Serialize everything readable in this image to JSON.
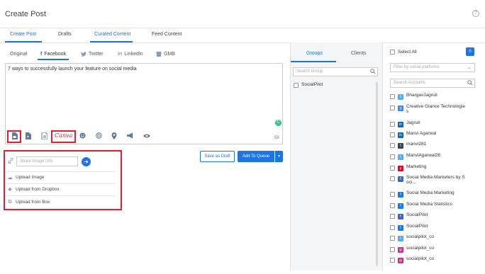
{
  "page": {
    "title": "Create Post",
    "help_icon": "?"
  },
  "top_tabs": [
    "Create Post",
    "Drafts",
    "Curated Content",
    "Feed Content"
  ],
  "network_tabs": [
    {
      "label": "Original",
      "icon": ""
    },
    {
      "label": "Facebook",
      "icon": "f"
    },
    {
      "label": "Twitter",
      "icon": "twitter-icon"
    },
    {
      "label": "LinkedIn",
      "icon": "in"
    },
    {
      "label": "GMB",
      "icon": "gmb-icon"
    }
  ],
  "editor": {
    "text": "7 ways to successfully launch your feature on social media",
    "char_count": "58",
    "badge": "C"
  },
  "toolbar": {
    "canva_label": "Canva"
  },
  "actions": {
    "save_draft": "Save as Draft",
    "add_queue": "Add To Queue",
    "caret": "▾"
  },
  "media": {
    "url_placeholder": "Share Image Urls",
    "go": "➔",
    "uploads": [
      "Upload Image",
      "Upload from Dropbox",
      "Upload from Box"
    ]
  },
  "groups_panel": {
    "tabs": [
      "Groups",
      "Clients"
    ],
    "search_placeholder": "Search Group",
    "items": [
      "SocialPilot"
    ]
  },
  "accounts_panel": {
    "select_all": "Select All",
    "selected_count": "0",
    "filter_placeholder": "Filter by social platforms",
    "search_placeholder": "Search Accounts",
    "accounts": [
      {
        "name": "BhargavJagruti",
        "platform": "twitter",
        "color": "#55acee"
      },
      {
        "name": "Creative Glance Technologie s",
        "platform": "gmb",
        "color": "#4285f4"
      },
      {
        "name": "Jagruti",
        "platform": "linkedin",
        "color": "#0a66c2"
      },
      {
        "name": "Manvi Agarwal",
        "platform": "linkedin",
        "color": "#0a66c2"
      },
      {
        "name": "manvi281",
        "platform": "tumblr",
        "color": "#35465c"
      },
      {
        "name": "ManviAgarwal28",
        "platform": "twitter",
        "color": "#55acee"
      },
      {
        "name": "Marketing",
        "platform": "pinterest",
        "color": "#e60023"
      },
      {
        "name": "Social Media Marketers by S oci...",
        "platform": "facebook-group",
        "color": "#4267b2"
      },
      {
        "name": "Social Media Marketing",
        "platform": "facebook",
        "color": "#1877f2"
      },
      {
        "name": "Social Media Statistics",
        "platform": "facebook",
        "color": "#1877f2"
      },
      {
        "name": "SocialPilot",
        "platform": "facebook-group",
        "color": "#4267b2"
      },
      {
        "name": "SocialPilot",
        "platform": "facebook",
        "color": "#1877f2"
      },
      {
        "name": "socialpilot_co",
        "platform": "twitter",
        "color": "#55acee"
      },
      {
        "name": "socialpilot_co",
        "platform": "instagram",
        "color": "#c13584"
      },
      {
        "name": "socialpilot_co",
        "platform": "instagram",
        "color": "#c13584"
      }
    ]
  }
}
